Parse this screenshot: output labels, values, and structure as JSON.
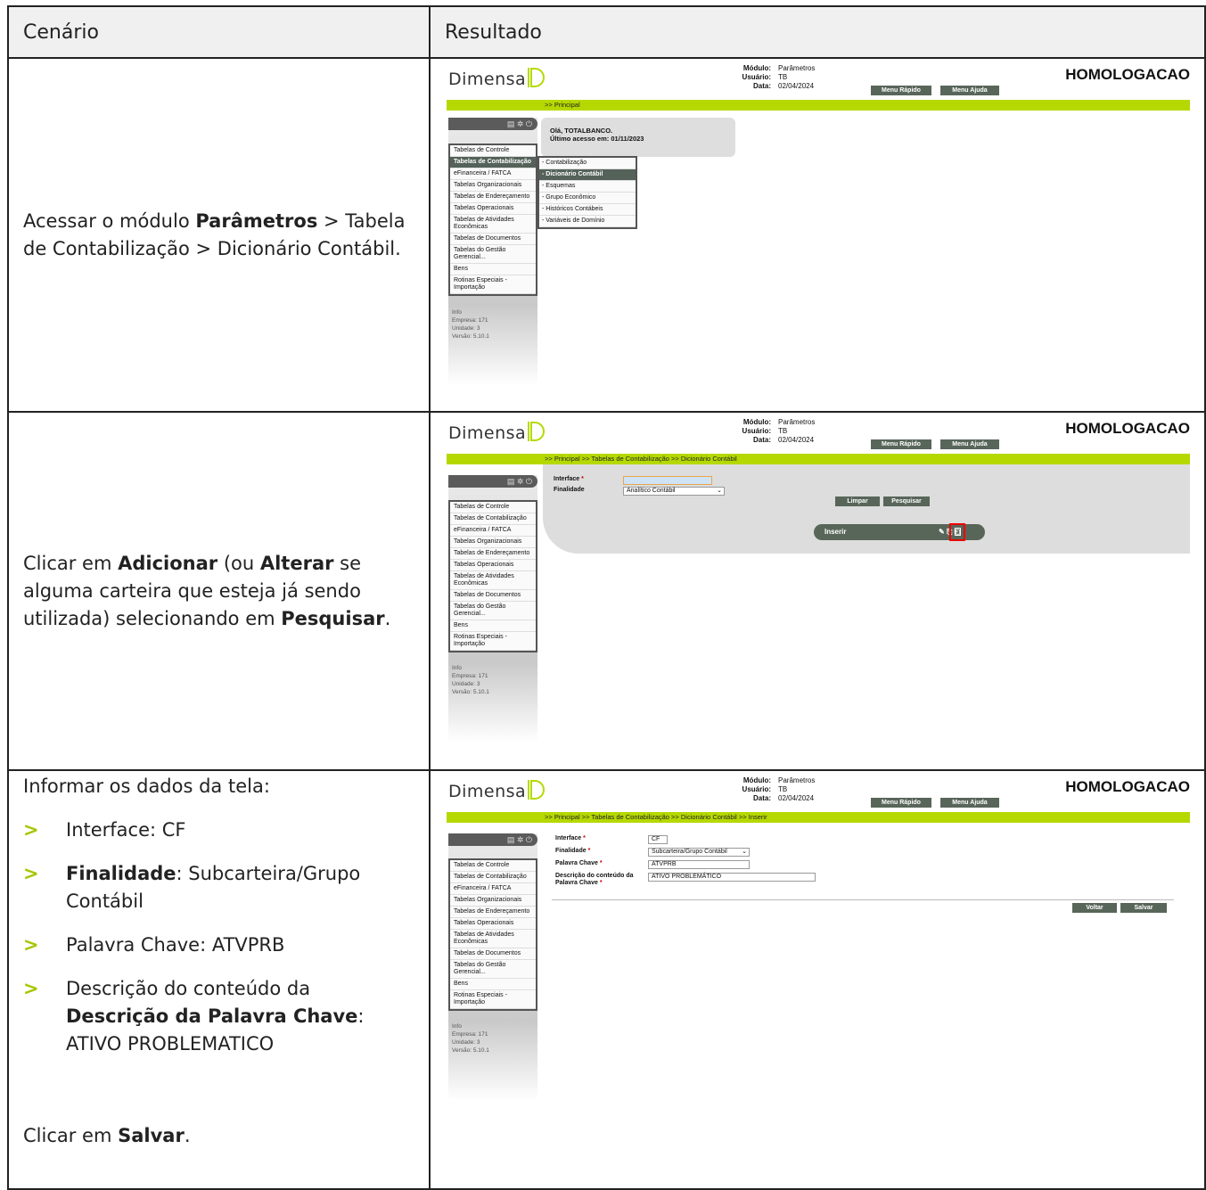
{
  "table": {
    "header_left": "Cenário",
    "header_right": "Resultado"
  },
  "row1": {
    "text_pre": "Acessar o módulo ",
    "text_bold": "Parâmetros",
    "text_post": " > Tabela de Contabilização > Dicionário Contábil."
  },
  "row2": {
    "t1": "Clicar em ",
    "b1": "Adicionar",
    "t2": " (ou ",
    "b2": "Alterar",
    "t3": " se alguma carteira que esteja já sendo utilizada) selecionando em ",
    "b3": "Pesquisar",
    "t4": "."
  },
  "row3": {
    "intro": "Informar os dados da tela:",
    "bullet_marker": ">",
    "b1": "Interface: CF",
    "b2_bold": "Finalidade",
    "b2_rest": ": Subcarteira/Grupo Contábil",
    "b3": "Palavra Chave: ATVPRB",
    "b4_pre": "Descrição do conteúdo da ",
    "b4_bold": "Descrição da Palavra Chave",
    "b4_post": ": ATIVO PROBLEMATICO",
    "save_pre": "Clicar em ",
    "save_bold": "Salvar",
    "save_post": "."
  },
  "app": {
    "logo": "Dimensa",
    "meta_modulo_label": "Módulo:",
    "meta_modulo": "Parâmetros",
    "meta_usuario_label": "Usuário:",
    "meta_usuario": "TB",
    "meta_data_label": "Data:",
    "meta_data": "02/04/2024",
    "env": "HOMOLOGACAO",
    "menu_rapido": "Menu Rápido",
    "menu_ajuda": "Menu Ajuda",
    "menu_items": [
      "Tabelas de Controle",
      "Tabelas de Contabilização",
      "eFinanceira / FATCA",
      "Tabelas Organizacionais",
      "Tabelas de Endereçamento",
      "Tabelas Operacionais",
      "Tabelas de Atividades Econômicas",
      "Tabelas de Documentos",
      "Tabelas do Gestão Gerencial...",
      "Bens",
      "Rotinas Especiais - Importação"
    ],
    "info_label": "Info",
    "info_empresa": "Empresa: 171",
    "info_unidade": "Unidade: 3",
    "info_versao": "Versão: 5.10.1"
  },
  "screen1": {
    "breadcrumb": ">> Principal",
    "welcome_line1": "Olá, TOTALBANCO.",
    "welcome_line2": "Último acesso em:  01/11/2023",
    "submenu": [
      "- Contabilização",
      "- Dicionário Contábil",
      "- Esquemas",
      "- Grupo Econômico",
      "- Históricos Contábeis",
      "- Variáveis de Domínio"
    ]
  },
  "screen2": {
    "breadcrumb": ">> Principal  >> Tabelas de Contabilização  >> Dicionário Contábil",
    "interface_label": "Interface",
    "finalidade_label": "Finalidade",
    "finalidade_value": "Analítico Contábil",
    "limpar": "Limpar",
    "pesquisar": "Pesquisar",
    "inserir": "Inserir"
  },
  "screen3": {
    "breadcrumb": ">> Principal  >> Tabelas de Contabilização  >> Dicionário Contábil  >> Inserir",
    "interface_label": "Interface",
    "interface_value": "CF",
    "finalidade_label": "Finalidade",
    "finalidade_value": "Subcarteira/Grupo Contábil",
    "palavra_label": "Palavra Chave",
    "palavra_value": "ATVPRB",
    "desc_label": "Descrição do conteúdo da Palavra Chave",
    "desc_value": "ATIVO PROBLEMÁTICO",
    "voltar": "Voltar",
    "salvar": "Salvar"
  },
  "colors": {
    "accent": "#b5d900",
    "app_dark": "#58665a",
    "bullet": "#a7c500"
  }
}
